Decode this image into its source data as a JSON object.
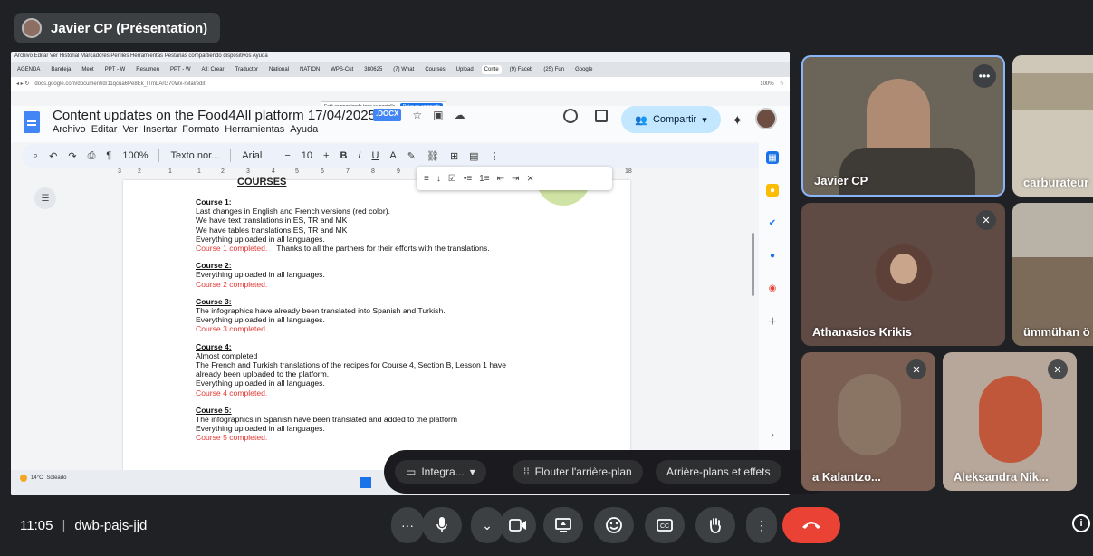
{
  "meeting": {
    "presenter_label": "Javier CP (Présentation)",
    "time": "11:05",
    "code": "dwb-pajs-jjd"
  },
  "shared_screen": {
    "os_menu": "Archivo  Editar  Ver  Historial  Marcadores  Perfiles  Herramientas  Pestañas compartiendo dispositivos  Ayuda",
    "tabs": [
      "AGENDA",
      "Bandeja",
      "Meet",
      "PPT - W",
      "Resumen",
      "PPT - W",
      "All: Crear",
      "Traductor",
      "National",
      "NATION",
      "WPS-Cut",
      "380625",
      "(7) What",
      "Courses",
      "Upload",
      "Conte",
      "(9) Faceb",
      "(25) Fun",
      "Google"
    ],
    "url": "docs.google.com/document/d/11qcua6Pe8Ek_lTmLArG70Wx-rMal/edit",
    "zoom_badge": "100%",
    "share_banner_text": "Está compartiendo toda su pantalla.",
    "share_banner_stop": "Dejar de compartir",
    "doc_title": "Content updates on the Food4All platform 17/04/2025",
    "doc_badge": ".DOCX",
    "doc_menu": [
      "Archivo",
      "Editar",
      "Ver",
      "Insertar",
      "Formato",
      "Herramientas",
      "Ayuda"
    ],
    "share_button": "Compartir",
    "toolbar": {
      "zoom": "100%",
      "style": "Texto nor...",
      "font": "Arial",
      "size": "10"
    },
    "ruler_ticks": [
      "3",
      "2",
      "1",
      "1",
      "2",
      "3",
      "4",
      "5",
      "6",
      "7",
      "8",
      "9",
      "18"
    ],
    "page_heading": "COURSES",
    "courses": [
      {
        "title": "Course 1:",
        "lines": [
          "Last changes in English and French versions (red color).",
          "We have text translations in ES, TR and MK",
          "We have tables translations ES, TR and MK",
          "Everything uploaded in all languages."
        ],
        "status": "Course 1 completed.",
        "extra": "Thanks to all the partners for their efforts with the translations."
      },
      {
        "title": "Course 2:",
        "lines": [
          "Everything uploaded in all languages."
        ],
        "status": "Course 2 completed.",
        "extra": ""
      },
      {
        "title": "Course 3:",
        "lines": [
          "The infographics have already been translated into Spanish and Turkish.",
          "Everything uploaded in all languages."
        ],
        "status": "Course 3 completed.",
        "extra": ""
      },
      {
        "title": "Course 4:",
        "lines": [
          "Almost completed",
          "The French and Turkish translations of the recipes for Course 4, Section B, Lesson 1 have",
          "already been uploaded to the platform.",
          "Everything uploaded in all languages."
        ],
        "status": "Course 4 completed.",
        "extra": ""
      },
      {
        "title": "Course 5:",
        "lines": [
          "The infographics in Spanish have been translated and added to the platform",
          "Everything uploaded in all languages."
        ],
        "status": "Course 5 completed.",
        "extra": ""
      }
    ],
    "weather": [
      "14°C",
      "Soleado"
    ]
  },
  "effects_bar": {
    "camera_label": "Integra...",
    "blur_label": "Flouter l'arrière-plan",
    "backgrounds_label": "Arrière-plans et effets"
  },
  "participants": [
    {
      "name": "Javier CP",
      "muted": false
    },
    {
      "name": "carburateur",
      "muted": false
    },
    {
      "name": "Athanasios Krikis",
      "muted": true
    },
    {
      "name": "ümmühan ö",
      "muted": false
    },
    {
      "name": "a Kalantzo...",
      "muted": true
    },
    {
      "name": "Aleksandra Nik...",
      "muted": true
    }
  ],
  "colors": {
    "accent": "#8ab4f8",
    "hangup": "#ea4335",
    "completed": "#e53935",
    "share_btn": "#c2e7ff"
  },
  "icons": [
    "more-icon",
    "mic-icon",
    "chevron-up-icon",
    "camera-icon",
    "present-icon",
    "emoji-icon",
    "captions-icon",
    "raise-hand-icon",
    "more-vert-icon",
    "hangup-icon",
    "info-icon",
    "settings-icon"
  ]
}
